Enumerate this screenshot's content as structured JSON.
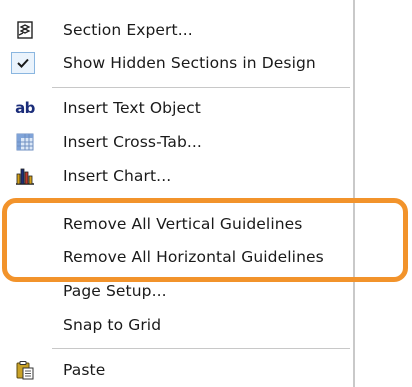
{
  "menu": {
    "items": [
      {
        "label": "Section Expert...",
        "icon": "section-expert-icon"
      },
      {
        "label": "Show Hidden Sections in Design",
        "icon": "checkmark-icon",
        "checked": true
      },
      {
        "label": "Insert Text Object",
        "icon": "text-object-icon",
        "icon_text": "ab"
      },
      {
        "label": "Insert Cross-Tab...",
        "icon": "cross-tab-icon"
      },
      {
        "label": "Insert Chart...",
        "icon": "chart-icon"
      },
      {
        "label": "Remove All Vertical Guidelines",
        "icon": ""
      },
      {
        "label": "Remove All Horizontal Guidelines",
        "icon": ""
      },
      {
        "label": "Page Setup...",
        "icon": ""
      },
      {
        "label": "Snap to Grid",
        "icon": ""
      },
      {
        "label": "Paste",
        "icon": "paste-icon"
      }
    ]
  },
  "colors": {
    "highlight": "#f2932b",
    "check_border": "#8ab6e0",
    "check_fill": "#eaf3fc",
    "text": "#1a1a1a"
  }
}
